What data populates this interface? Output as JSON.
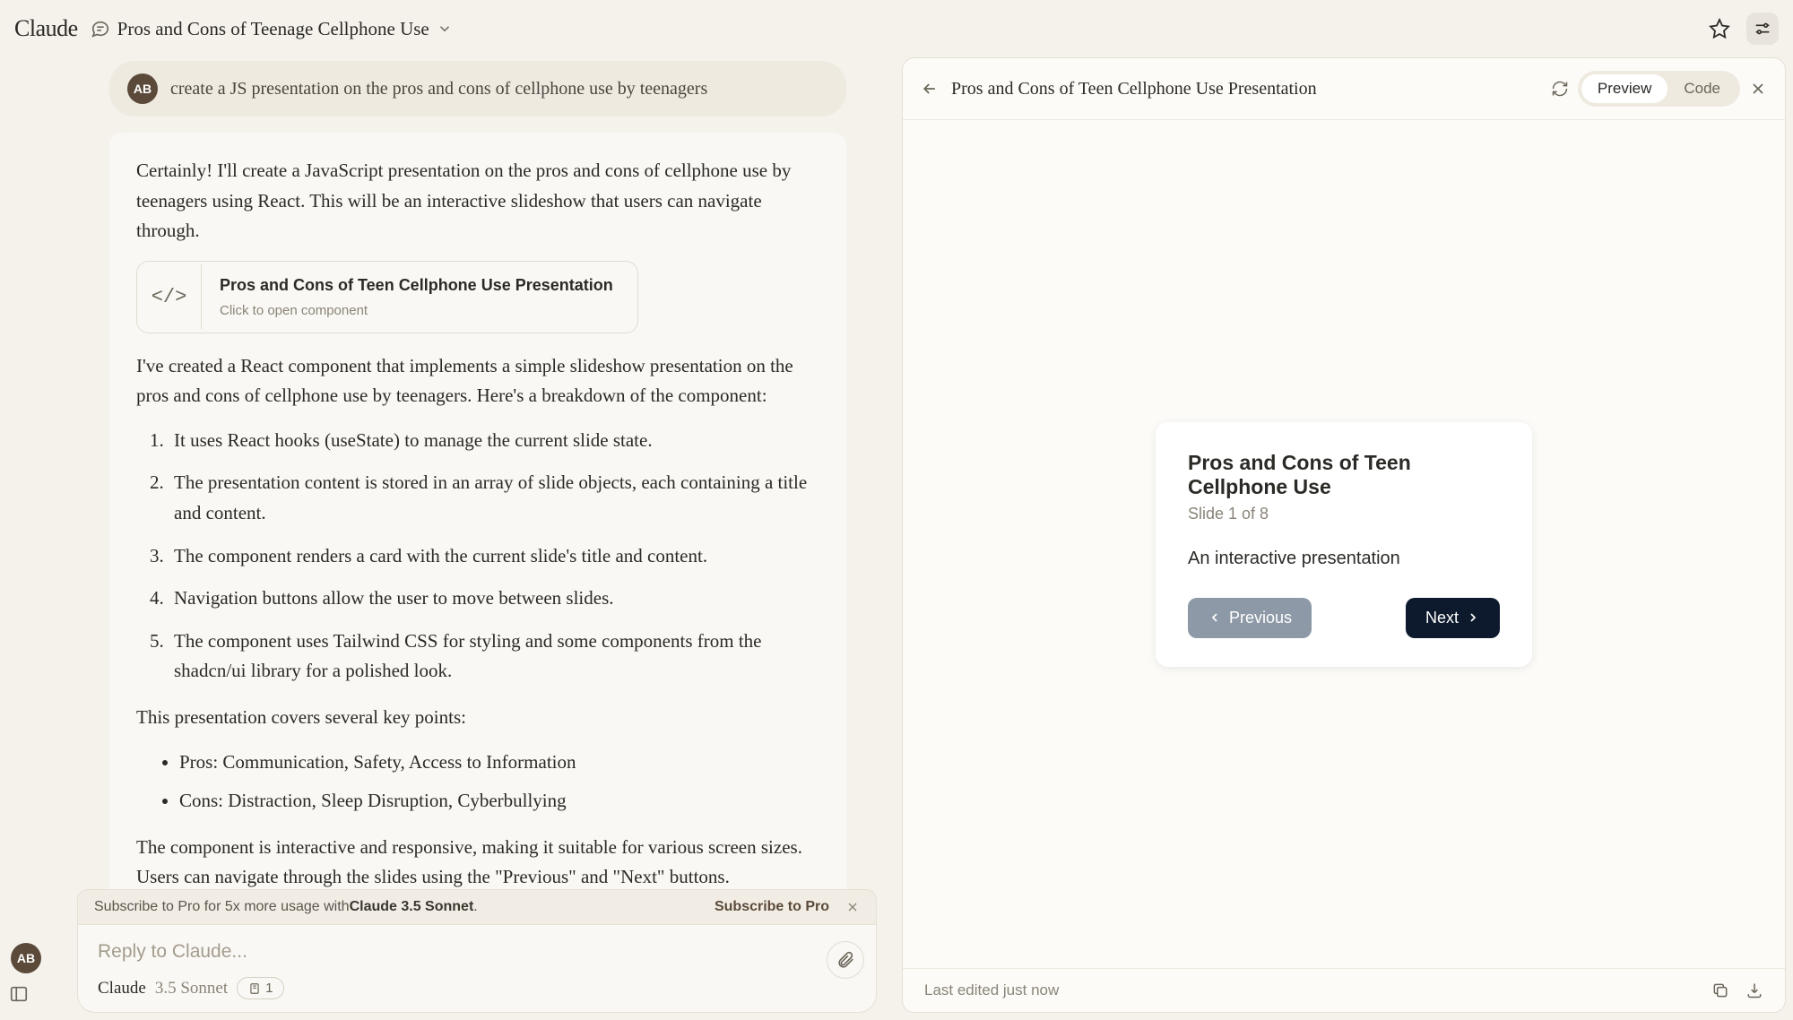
{
  "header": {
    "logo": "Claude",
    "chat_title": "Pros and Cons of Teenage Cellphone Use"
  },
  "user_message": {
    "avatar": "AB",
    "text": "create a JS presentation on the pros and cons of cellphone use by teenagers"
  },
  "assistant": {
    "intro": "Certainly! I'll create a JavaScript presentation on the pros and cons of cellphone use by teenagers using React. This will be an interactive slideshow that users can navigate through.",
    "artifact_title": "Pros and Cons of Teen Cellphone Use Presentation",
    "artifact_sub": "Click to open component",
    "after_artifact": "I've created a React component that implements a simple slideshow presentation on the pros and cons of cellphone use by teenagers. Here's a breakdown of the component:",
    "list": [
      "It uses React hooks (useState) to manage the current slide state.",
      "The presentation content is stored in an array of slide objects, each containing a title and content.",
      "The component renders a card with the current slide's title and content.",
      "Navigation buttons allow the user to move between slides.",
      "The component uses Tailwind CSS for styling and some components from the shadcn/ui library for a polished look."
    ],
    "key_points_intro": "This presentation covers several key points:",
    "bullets": [
      "Pros: Communication, Safety, Access to Information",
      "Cons: Distraction, Sleep Disruption, Cyberbullying"
    ],
    "outro": "The component is interactive and responsive, making it suitable for various screen sizes. Users can navigate through the slides using the \"Previous\" and \"Next\" buttons."
  },
  "banner": {
    "prefix": "Subscribe to Pro for 5x more usage with ",
    "bold": "Claude 3.5 Sonnet",
    "suffix": ".",
    "link": "Subscribe to Pro"
  },
  "input": {
    "placeholder": "Reply to Claude...",
    "model": "Claude",
    "version": "3.5 Sonnet",
    "attachment_count": "1",
    "left_avatar": "AB"
  },
  "artifact_panel": {
    "title": "Pros and Cons of Teen Cellphone Use Presentation",
    "preview": "Preview",
    "code": "Code",
    "slide": {
      "title": "Pros and Cons of Teen Cellphone Use",
      "counter": "Slide 1 of 8",
      "content": "An interactive presentation",
      "prev": "Previous",
      "next": "Next"
    },
    "footer": "Last edited just now"
  }
}
